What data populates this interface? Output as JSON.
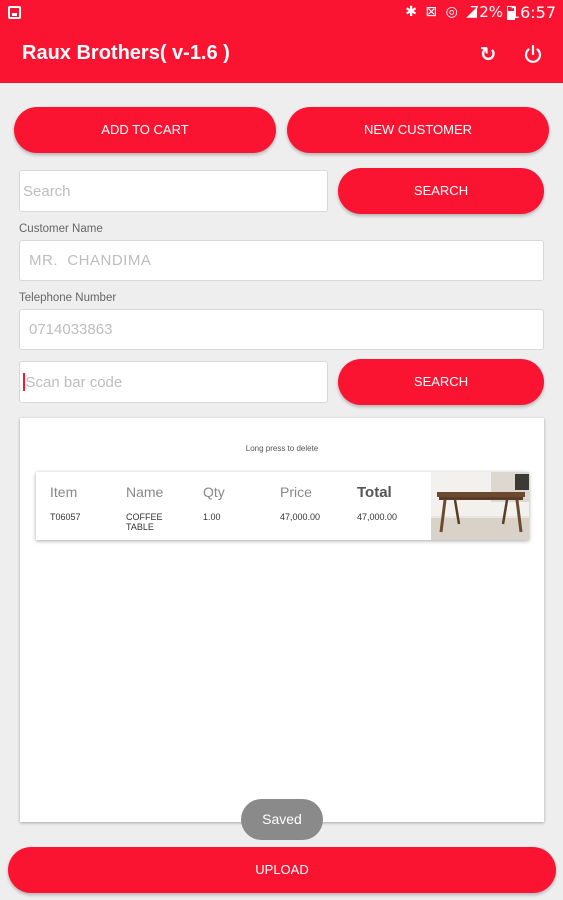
{
  "status_bar": {
    "icons": "✱ ⊠ ◎ ◢",
    "battery": "72%",
    "time": "16:57"
  },
  "app_bar": {
    "title": "Raux Brothers( v-1.6 )",
    "refresh_icon": "refresh-icon",
    "power_icon": "power-icon"
  },
  "buttons": {
    "add_to_cart": "ADD TO CART",
    "new_customer": "NEW CUSTOMER",
    "search_top": "SEARCH",
    "search_barcode": "SEARCH",
    "upload": "UPLOAD"
  },
  "search": {
    "placeholder": "Search"
  },
  "customer": {
    "name_label": "Customer Name",
    "name_value": "MR.  CHANDIMA",
    "phone_label": "Telephone Number",
    "phone_value": "0714033863"
  },
  "barcode": {
    "placeholder": "Scan bar code"
  },
  "cart": {
    "hint": "Long press to delete",
    "columns": [
      "Item",
      "Name",
      "Qty",
      "Price",
      "Total"
    ],
    "rows": [
      {
        "item": "T06057",
        "name": "COFFEE TABLE",
        "qty": "1.00",
        "price": "47,000.00",
        "total": "47,000.00"
      }
    ]
  },
  "toast": "Saved",
  "colors": {
    "accent": "#fb1432",
    "background": "#eeeeee",
    "toast": "#8a8a8a"
  }
}
